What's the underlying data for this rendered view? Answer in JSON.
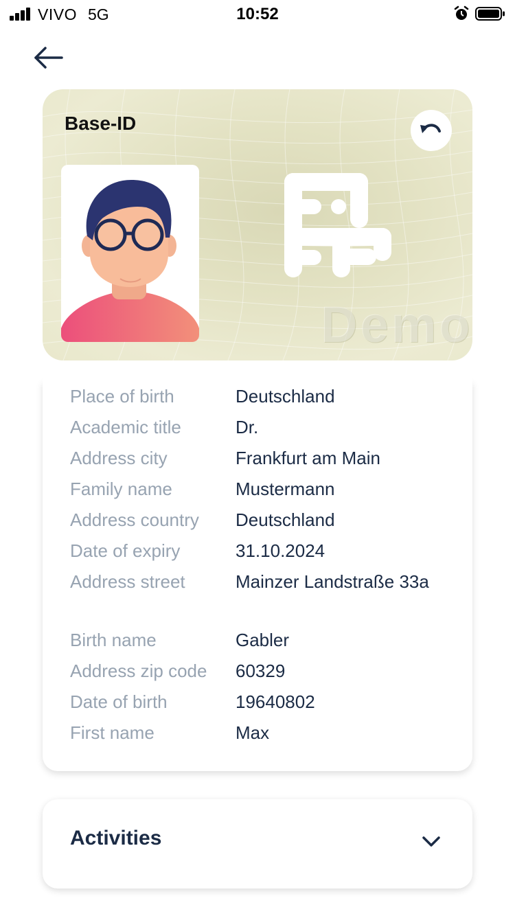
{
  "status_bar": {
    "carrier": "VIVO",
    "network": "5G",
    "time": "10:52"
  },
  "card": {
    "title": "Base-ID",
    "watermark": "Demo"
  },
  "details": [
    {
      "label": "Place of birth",
      "value": "Deutschland"
    },
    {
      "label": "Academic title",
      "value": "Dr."
    },
    {
      "label": "Address city",
      "value": "Frankfurt am Main"
    },
    {
      "label": "Family name",
      "value": "Mustermann"
    },
    {
      "label": "Address country",
      "value": "Deutschland"
    },
    {
      "label": "Date of expiry",
      "value": "31.10.2024"
    },
    {
      "label": "Address street",
      "value": "Mainzer Landstraße 33a"
    },
    {
      "label": "Birth name",
      "value": "Gabler"
    },
    {
      "label": "Address zip code",
      "value": "60329"
    },
    {
      "label": "Date of birth",
      "value": "19640802"
    },
    {
      "label": "First name",
      "value": "Max"
    }
  ],
  "activities": {
    "title": "Activities"
  },
  "colors": {
    "text_dark": "#1b2b45",
    "label_gray": "#97a3b1",
    "card_bg": "#e3e2c3",
    "avatar_hair": "#2b3470",
    "avatar_shirt": "#ec5d7b"
  }
}
